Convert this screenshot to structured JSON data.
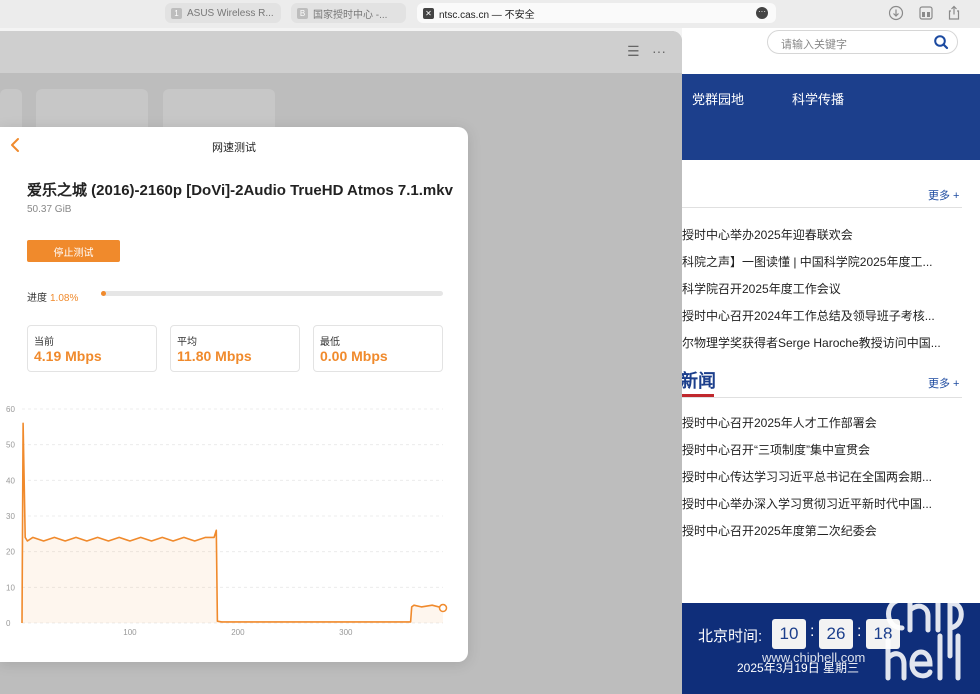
{
  "browser": {
    "tabs": [
      {
        "label": "ASUS Wireless R...",
        "fav": "1"
      },
      {
        "label": "国家授时中心 -...",
        "fav": "B"
      },
      {
        "label": "ntsc.cas.cn — 不安全",
        "fav": "✕"
      }
    ],
    "icons": [
      "download-icon",
      "tab-overview-icon",
      "share-icon",
      "more-icon"
    ]
  },
  "site": {
    "search_placeholder": "请输入关键字",
    "nav": [
      "党群园地",
      "科学传播"
    ],
    "more_label": "更多 +",
    "section1_items": [
      "授时中心举办2025年迎春联欢会",
      "科院之声】一图读懂 | 中国科学院2025年度工...",
      "科学院召开2025年度工作会议",
      "授时中心召开2024年工作总结及领导班子考核...",
      "尔物理学奖获得者Serge Haroche教授访问中国..."
    ],
    "news_title": "新闻",
    "news_items": [
      "授时中心召开2025年人才工作部署会",
      "授时中心召开“三项制度”集中宣贯会",
      "授时中心传达学习习近平总书记在全国两会期...",
      "授时中心举办深入学习贯彻习近平新时代中国...",
      "授时中心召开2025年度第二次纪委会"
    ],
    "clock": {
      "label": "北京时间:",
      "hour": "10",
      "minute": "26",
      "second": "18",
      "date": "2025年3月19日 星期三"
    },
    "watermark_url": "www.chiphell.com"
  },
  "modal": {
    "title": "网速测试",
    "file_name": "爱乐之城 (2016)-2160p [DoVi]-2Audio TrueHD Atmos 7.1.mkv",
    "file_size": "50.37 GiB",
    "stop_label": "停止测试",
    "progress_label": "进度",
    "progress_text": "1.08%",
    "progress_fraction": 0.0108,
    "stats": [
      {
        "label": "当前",
        "value": "4.19 Mbps"
      },
      {
        "label": "平均",
        "value": "11.80 Mbps"
      },
      {
        "label": "最低",
        "value": "0.00 Mbps"
      }
    ]
  },
  "colors": {
    "accent": "#f08a2c",
    "site_blue": "#1c3f8c",
    "news_red": "#c0282d"
  },
  "chart_data": {
    "type": "line",
    "title": "",
    "xlabel": "",
    "ylabel": "",
    "xlim": [
      0,
      390
    ],
    "ylim": [
      0,
      60
    ],
    "x_ticks": [
      100,
      200,
      300
    ],
    "y_ticks": [
      0,
      10,
      20,
      30,
      40,
      50,
      60
    ],
    "grid": true,
    "series": [
      {
        "x": [
          0,
          1,
          3,
          5,
          10,
          20,
          30,
          40,
          50,
          60,
          70,
          80,
          90,
          100,
          110,
          120,
          130,
          140,
          150,
          160,
          170,
          178,
          180,
          181,
          185,
          200,
          250,
          300,
          350,
          360,
          361,
          363,
          370,
          380,
          390
        ],
        "y": [
          0,
          56,
          24,
          23,
          24,
          23,
          24,
          23,
          24,
          23,
          24,
          23,
          24,
          23,
          24,
          23,
          24,
          23,
          24,
          23,
          24,
          24,
          26,
          0.5,
          0.3,
          0.3,
          0.3,
          0.3,
          0.3,
          0.3,
          4.5,
          5,
          4.5,
          5,
          4.2
        ]
      }
    ]
  }
}
